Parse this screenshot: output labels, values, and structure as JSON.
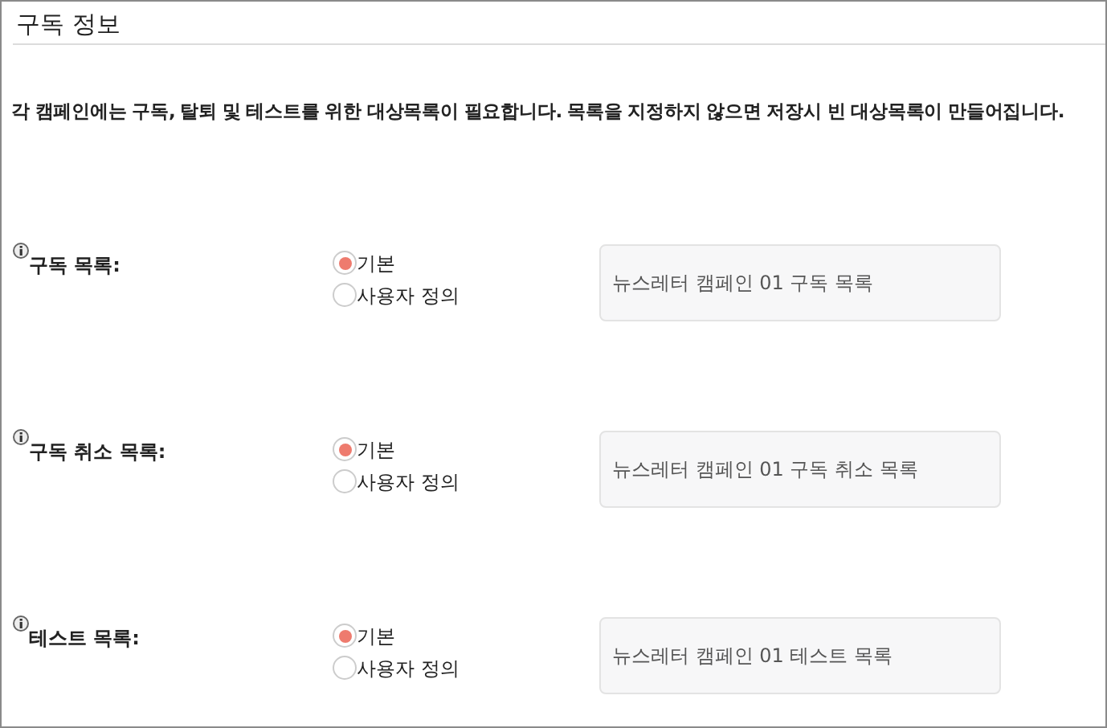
{
  "section": {
    "title": "구독 정보"
  },
  "description": "각 캠페인에는 구독, 탈퇴 및 테스트를 위한 대상목록이 필요합니다. 목록을 지정하지 않으면 저장시 빈 대상목록이 만들어집니다.",
  "rows": [
    {
      "label": "구독 목록:",
      "options": [
        {
          "label": "기본",
          "selected": true
        },
        {
          "label": "사용자 정의",
          "selected": false
        }
      ],
      "value": "뉴스레터 캠페인 01 구독 목록"
    },
    {
      "label": "구독 취소 목록:",
      "options": [
        {
          "label": "기본",
          "selected": true
        },
        {
          "label": "사용자 정의",
          "selected": false
        }
      ],
      "value": "뉴스레터 캠페인 01 구독 취소 목록"
    },
    {
      "label": "테스트 목록:",
      "options": [
        {
          "label": "기본",
          "selected": true
        },
        {
          "label": "사용자 정의",
          "selected": false
        }
      ],
      "value": "뉴스레터 캠페인 01 테스트 목록"
    }
  ]
}
